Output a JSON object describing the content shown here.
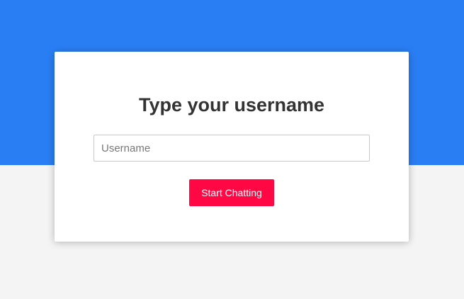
{
  "colors": {
    "top_band": "#2a7ef4",
    "page_background": "#f4f4f4",
    "card_background": "#ffffff",
    "button_background": "#ff0844",
    "button_text": "#ffffff",
    "title_text": "#333333"
  },
  "login": {
    "title": "Type your username",
    "username_placeholder": "Username",
    "username_value": "",
    "submit_label": "Start Chatting"
  }
}
